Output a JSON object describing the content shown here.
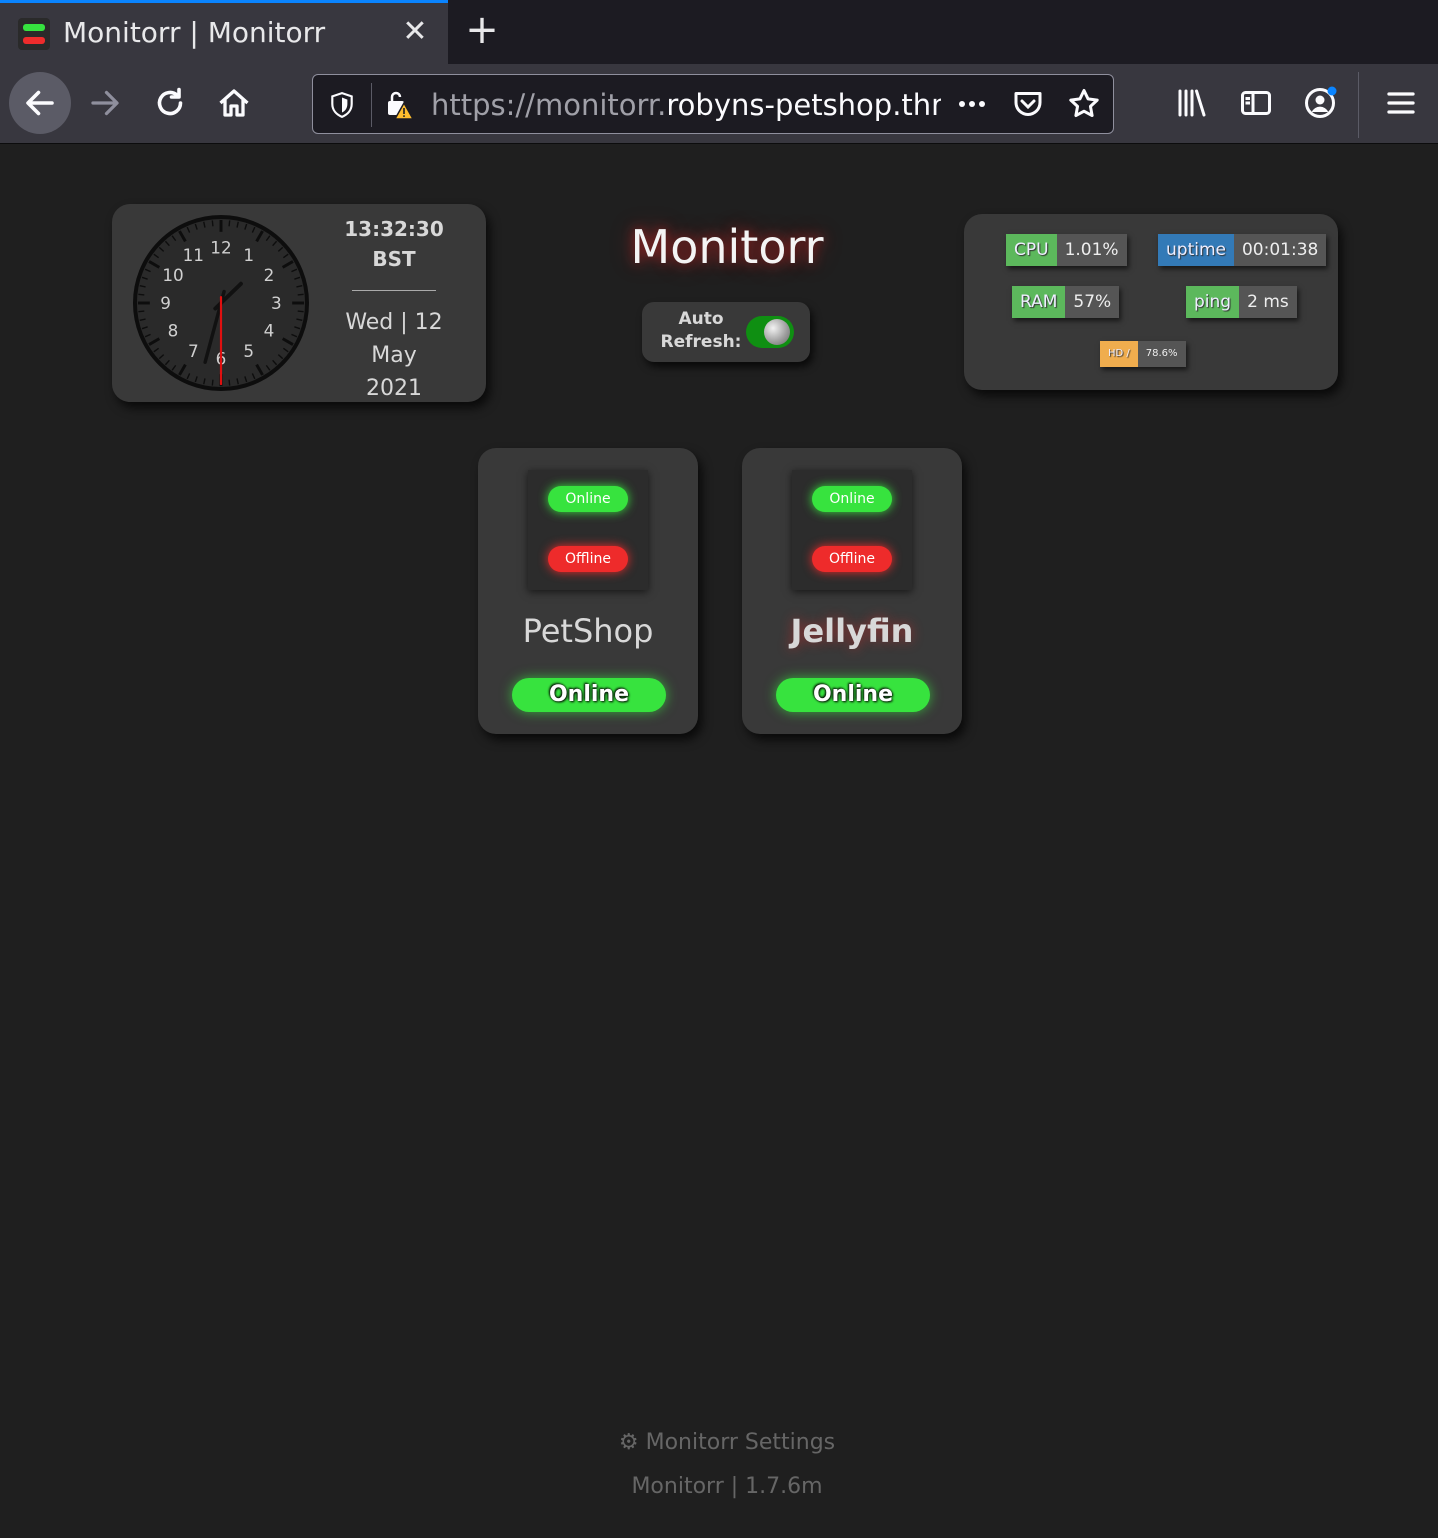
{
  "browser": {
    "tab_title": "Monitorr | Monitorr",
    "url_prefix": "https://monitorr.",
    "url_host": "robyns-petshop.thm",
    "icons": [
      "back-arrow-icon",
      "forward-arrow-icon",
      "reload-icon",
      "home-icon",
      "shield-icon",
      "insecure-lock-icon",
      "more-icon",
      "pocket-icon",
      "bookmark-star-icon",
      "library-icon",
      "sidebar-icon",
      "account-icon",
      "menu-icon"
    ]
  },
  "clock": {
    "time": "13:32:30",
    "zone": "BST",
    "date_line1": "Wed | 12",
    "date_line2": "May",
    "date_line3": "2021",
    "numerals": [
      "12",
      "1",
      "2",
      "3",
      "4",
      "5",
      "6",
      "7",
      "8",
      "9",
      "10",
      "11"
    ]
  },
  "header": {
    "title": "Monitorr",
    "auto_refresh_line1": "Auto",
    "auto_refresh_line2": "Refresh:",
    "auto_refresh_on": true
  },
  "stats": {
    "cpu_label": "CPU",
    "cpu_value": "1.01%",
    "uptime_label": "uptime",
    "uptime_value": "00:01:38",
    "ram_label": "RAM",
    "ram_value": "57%",
    "ping_label": "ping",
    "ping_value": "2 ms",
    "hd_label": "HD /",
    "hd_value": "78.6%"
  },
  "services": [
    {
      "name": "PetShop",
      "preview_online": "Online",
      "preview_offline": "Offline",
      "status": "Online"
    },
    {
      "name": "Jellyfin",
      "preview_online": "Online",
      "preview_offline": "Offline",
      "status": "Online"
    }
  ],
  "footer": {
    "settings_label": "Monitorr Settings",
    "version": "Monitorr | 1.7.6m"
  },
  "colors": {
    "online": "#37e33e",
    "offline": "#ee2b2b",
    "background": "#1f1f1f",
    "card": "#393939"
  }
}
